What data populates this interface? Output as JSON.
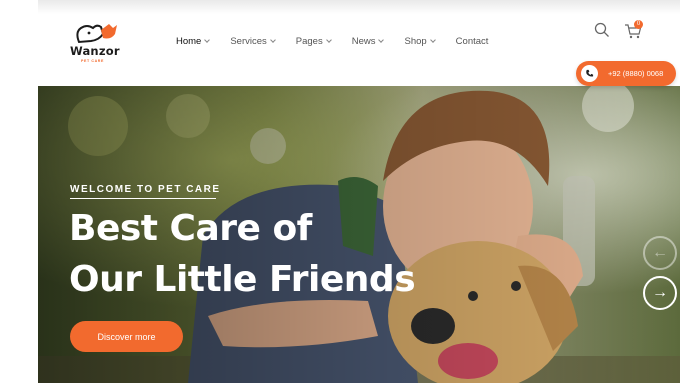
{
  "brand": {
    "name": "Wanzor",
    "tagline": "PET CARE",
    "accent_color": "#f26a2e"
  },
  "nav": {
    "items": [
      {
        "label": "Home",
        "dropdown": true,
        "active": true
      },
      {
        "label": "Services",
        "dropdown": true,
        "active": false
      },
      {
        "label": "Pages",
        "dropdown": true,
        "active": false
      },
      {
        "label": "News",
        "dropdown": true,
        "active": false
      },
      {
        "label": "Shop",
        "dropdown": true,
        "active": false
      },
      {
        "label": "Contact",
        "dropdown": false,
        "active": false
      }
    ]
  },
  "header_actions": {
    "search_icon": "search-icon",
    "cart_icon": "cart-icon",
    "cart_count": "0",
    "phone": "+92 (8880) 0068",
    "phone_icon": "phone-icon"
  },
  "hero": {
    "eyebrow": "WELCOME TO PET CARE",
    "title_line_1": "Best Care of",
    "title_line_2": "Our Little Friends",
    "cta_label": "Discover more",
    "prev_icon": "arrow-left-icon",
    "next_icon": "arrow-right-icon",
    "prev_glyph": "←",
    "next_glyph": "→"
  }
}
